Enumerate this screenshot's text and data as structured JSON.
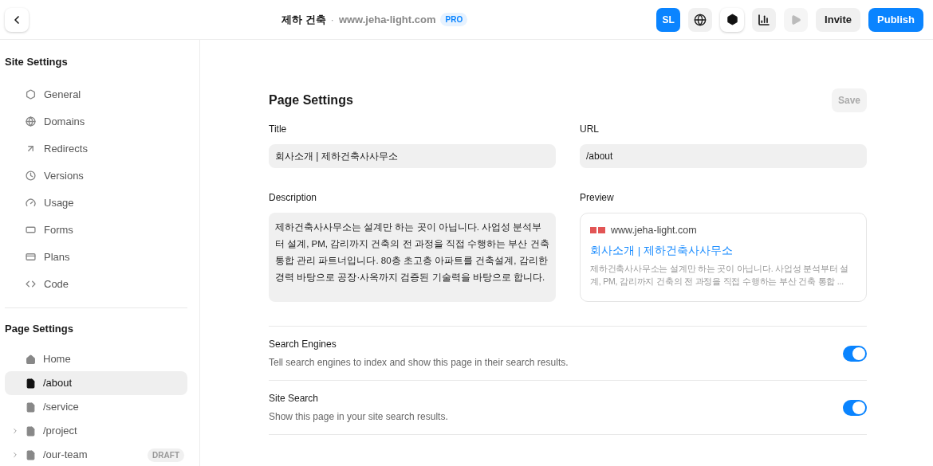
{
  "header": {
    "site_name": "제하 건축",
    "separator": "·",
    "domain": "www.jeha-light.com",
    "plan_badge": "PRO",
    "avatar": "SL",
    "invite": "Invite",
    "publish": "Publish"
  },
  "sidebar": {
    "site_settings": {
      "title": "Site Settings",
      "items": [
        {
          "label": "General"
        },
        {
          "label": "Domains"
        },
        {
          "label": "Redirects"
        },
        {
          "label": "Versions"
        },
        {
          "label": "Usage"
        },
        {
          "label": "Forms"
        },
        {
          "label": "Plans"
        },
        {
          "label": "Code"
        }
      ]
    },
    "page_settings": {
      "title": "Page Settings",
      "items": [
        {
          "label": "Home",
          "kind": "home",
          "selected": false
        },
        {
          "label": "/about",
          "kind": "page",
          "selected": true
        },
        {
          "label": "/service",
          "kind": "page",
          "selected": false
        },
        {
          "label": "/project",
          "kind": "page",
          "selected": false,
          "expanded": false
        },
        {
          "label": "/our-team",
          "kind": "page",
          "selected": false,
          "expanded": false,
          "badge": "DRAFT"
        }
      ]
    }
  },
  "main": {
    "title": "Page Settings",
    "save": "Save",
    "title_field": {
      "label": "Title",
      "value": "회사소개 | 제하건축사사무소"
    },
    "url_field": {
      "label": "URL",
      "value": "/about"
    },
    "description_field": {
      "label": "Description",
      "value": "제하건축사사무소는 설계만 하는 곳이 아닙니다. 사업성 분석부터 설계, PM, 감리까지 건축의 전 과정을 직접 수행하는 부산 건축 통합 관리 파트너입니다. 80층 초고층 아파트를 건축설계, 감리한 경력 바탕으로 공장·사옥까지 검증된 기술력을 바탕으로 합니다."
    },
    "preview": {
      "label": "Preview",
      "url": "www.jeha-light.com",
      "title": "회사소개 | 제하건축사사무소",
      "snippet": "제하건축사사무소는 설계만 하는 곳이 아닙니다. 사업성 분석부터 설계, PM, 감리까지 건축의 전 과정을 직접 수행하는 부산 건축 통합 ..."
    },
    "toggles": [
      {
        "title": "Search Engines",
        "description": "Tell search engines to index and show this page in their search results.",
        "on": true
      },
      {
        "title": "Site Search",
        "description": "Show this page in your site search results.",
        "on": true
      }
    ]
  }
}
